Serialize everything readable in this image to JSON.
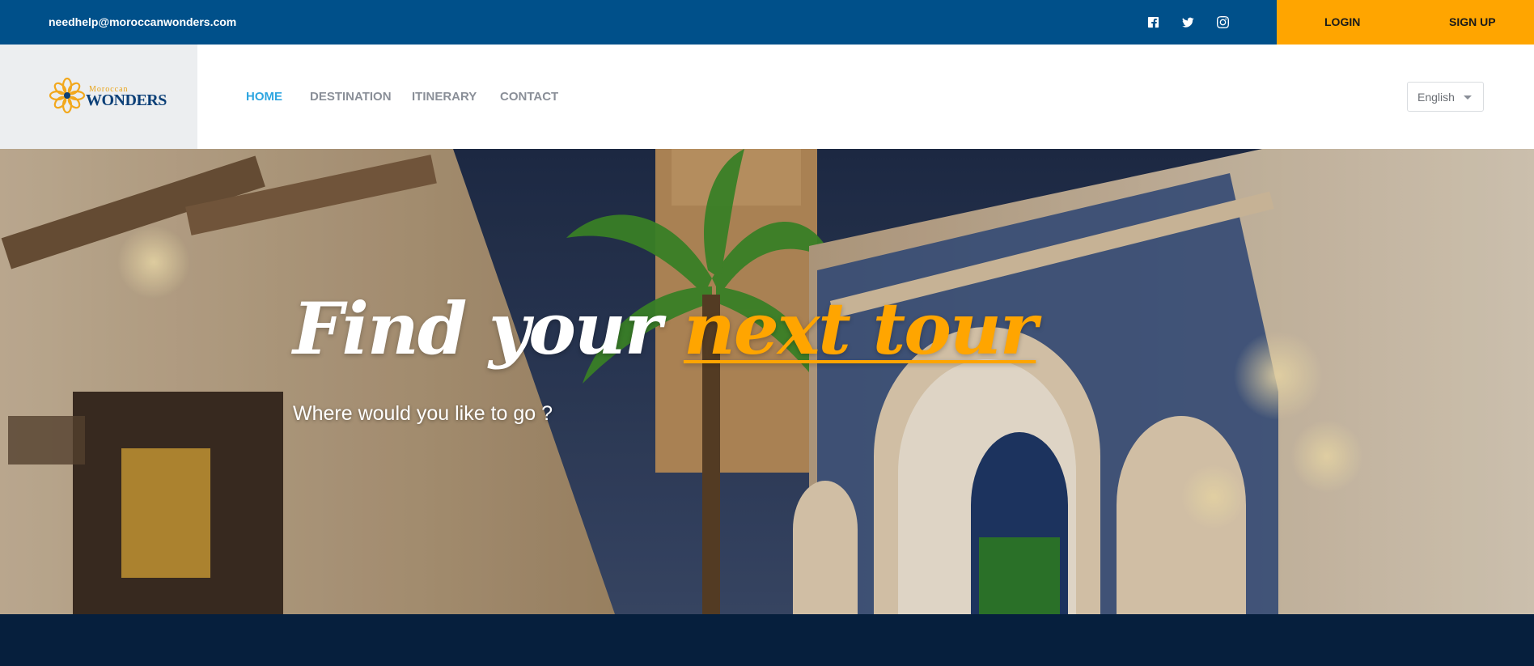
{
  "topbar": {
    "email": "needhelp@moroccanwonders.com",
    "social_icons": [
      "facebook-icon",
      "twitter-icon",
      "instagram-icon"
    ],
    "login_label": "LOGIN",
    "signup_label": "SIGN UP"
  },
  "brand": {
    "logo_small": "Moroccan",
    "logo_big": "WONDERS"
  },
  "nav": {
    "items": [
      {
        "label": "HOME",
        "active": true
      },
      {
        "label": "DESTINATION",
        "active": false
      },
      {
        "label": "ITINERARY",
        "active": false
      },
      {
        "label": "CONTACT",
        "active": false
      }
    ],
    "language": "English"
  },
  "hero": {
    "title_main": "Find your ",
    "title_accent": "next tour",
    "subtitle": "Where would you like to go ?"
  },
  "colors": {
    "topbar": "#00508a",
    "accent": "#ffa500",
    "nav_active": "#2fa6e0",
    "footer_band": "#061f3d"
  }
}
